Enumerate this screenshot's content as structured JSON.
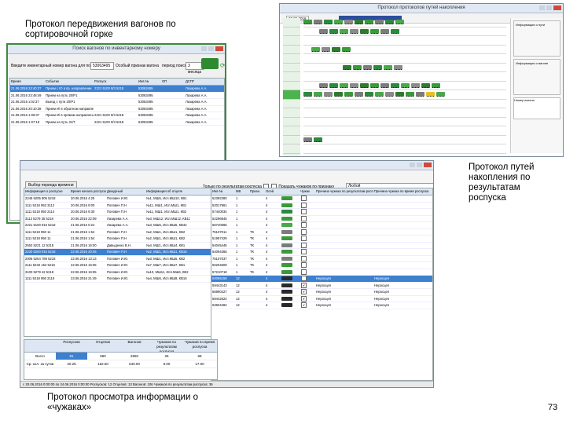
{
  "captions": {
    "top": [
      "Протокол передвижения вагонов по",
      "сортировочной горке"
    ],
    "right": [
      "Протокол путей",
      "накопления по",
      "результатам",
      "роспуска"
    ],
    "bottom": [
      "Протокол просмотра информации о",
      "«чужаках»"
    ]
  },
  "slide_number": "73",
  "win1": {
    "title": "Поиск вагонов по инвентарному номеру",
    "search_label": "Введите инвентарный номер вагона для поиска",
    "search_value": "53063495",
    "sign_label": "Особый признак вагона",
    "period_label": "период поиска",
    "period_value": "3 месяца",
    "find_button": "Найти",
    "columns": [
      "Время",
      "Событие",
      "Роспуск",
      "Инв №",
      "ОП",
      "ДСПГ"
    ],
    "rows": [
      [
        "21.06.2016 23:40:37",
        "Прием с Ю в пр. направлении",
        "2221 5100 9/3 5218",
        "53063495",
        "",
        "Лазарева А.А."
      ],
      [
        "21.06.2016 23:48:49",
        "Прием на путь 20/Р1",
        "",
        "53063495",
        "",
        "Лазарева А.А."
      ],
      [
        "21.06.2016 з:02:37",
        "Выезд с пути 20/Р1",
        "",
        "53063495",
        "",
        "Лазарева А.А."
      ],
      [
        "21.06.2016 20:10:38",
        "Прием И/ в обратном направлении",
        "",
        "53063495",
        "",
        "Лазарева А.А."
      ],
      [
        "21.06.2016 1:06:37",
        "Прием И/ в прямом направлении",
        "2221 5100 9/3 5218",
        "53063495",
        "",
        "Лазарева А.А."
      ],
      [
        "21.06.2016 1:07:18",
        "Прием на путь 31/Т",
        "2221 5100 9/3 5218",
        "53063495",
        "",
        "Лазарева А.А."
      ]
    ]
  },
  "win2": {
    "title": "Протокол протоколов путей накопления",
    "date": "22.06.2016",
    "panel_labels": [
      "Информация о пути",
      "Информация о вагоне",
      "Номер вагона"
    ]
  },
  "win3": {
    "title": "",
    "choose_period": "Выбор периода времени",
    "only_results": "Только по результатам роспуска",
    "show_aliens": "Показать чужаков по признаку",
    "reason_value": "Любой",
    "left_columns": [
      "Информация о роспуске",
      "Время начала роспуска",
      "Дежурный",
      "Информация об отцепе"
    ],
    "left_rows": [
      [
        "2246 5205 905 5218",
        "20.06.2016 4:25",
        "Попович И.Ю.",
        "№1, МШ5, Исп.МШ10, КВ1"
      ],
      [
        "1111 5218 953 3112",
        "20.06.2016 9:00",
        "Попович П.Н",
        "№11, МШ1, Исп.МШ1, КВ1"
      ],
      [
        "1111 5218 950 2114",
        "20.06.2016 9:30",
        "Попович П.Н",
        "№11, МШ1, Исп.МШ1, КВ2"
      ],
      [
        "3113 5279 35 5218",
        "20.06.2016 22:09",
        "Лазарева А.А.",
        "№3, МШ12, Исп.МШ12, КВ11"
      ],
      [
        "2221 5100 915 5218",
        "21.06.2016 0:24",
        "Лазарева А.А.",
        "№3, МШ5, Исп.МШ5, КВ42"
      ],
      [
        "1111 5218 950 11",
        "21.06.2016 1:54",
        "Попович П.Н",
        "№2, МШ1, Исп.МШ1, КВ2"
      ],
      [
        "1111 5218 950 11",
        "21.06.2016 1:54",
        "Попович П.Н",
        "№2, МШ1, Исп.МШ1, КВ2"
      ],
      [
        "2553 5221 12 5218",
        "21.06.2016 16:00",
        "Давыденко В.Н.",
        "№4, МШ1, Исп.МШ4, КВ1"
      ],
      [
        "2230 5200 915 5218",
        "22.06.2016 20:46",
        "Попович П.Н",
        "№2, МШ1, Исп.МШ1, КВ18"
      ],
      [
        "2006 5264 789 5218",
        "22.06.2016 13:13",
        "Попович И.Ю.",
        "№3, МШ1, Исп.МШ5, КВ2"
      ],
      [
        "2111 5232 152 5218",
        "22.06.2016 16:05",
        "Попович И.Ю.",
        "№7, МШ7, Исп.МШ7, КВ1"
      ],
      [
        "3100 5279 42 5218",
        "22.06.2016 16:55",
        "Попович И.Ю.",
        "№10, МШ11, Исп.МШ6, КВ2"
      ],
      [
        "1111 5218 950 2116",
        "23.06.2016 21:49",
        "Попович И.Ю.",
        "№4, МШ6, Исп.МШ8, КВ16"
      ]
    ],
    "right_columns": [
      "Инв №",
      "МВ",
      "Призн.",
      "Осей",
      "",
      "Чужак",
      "Причина чужака по результатам роспуска",
      "Причина чужака по время роспуска"
    ],
    "right_rows": [
      [
        "52392380",
        "1",
        "",
        "4",
        "",
        "",
        "",
        ""
      ],
      [
        "52017861",
        "1",
        "",
        "4",
        "",
        "",
        "",
        ""
      ],
      [
        "57440034",
        "1",
        "",
        "4",
        "",
        "",
        "",
        ""
      ],
      [
        "52296845",
        "1",
        "",
        "4",
        "",
        "",
        "",
        ""
      ],
      [
        "56740665",
        "1",
        "",
        "4",
        "",
        "",
        "",
        ""
      ],
      [
        "75107011",
        "1",
        "ТК",
        "4",
        "",
        "",
        "",
        ""
      ],
      [
        "51957429",
        "1",
        "ТК",
        "4",
        "",
        "",
        "",
        ""
      ],
      [
        "54045446",
        "1",
        "ТК",
        "4",
        "",
        "",
        "",
        ""
      ],
      [
        "54094366",
        "1",
        "ТК",
        "4",
        "",
        "",
        "",
        ""
      ],
      [
        "75107037",
        "1",
        "ТК",
        "4",
        "",
        "",
        "",
        ""
      ],
      [
        "50204509",
        "1",
        "ТК",
        "4",
        "",
        "",
        "",
        ""
      ],
      [
        "57210718",
        "1",
        "ТК",
        "4",
        "",
        "",
        "",
        ""
      ],
      [
        "50065158",
        "12",
        "",
        "4",
        "",
        "✔",
        "Неросцеп",
        "Неросцеп"
      ],
      [
        "59443143",
        "12",
        "",
        "4",
        "",
        "✔",
        "Неросцеп",
        "Неросцеп"
      ],
      [
        "56990227",
        "12",
        "",
        "4",
        "",
        "✔",
        "Неросцеп",
        "Неросцеп"
      ],
      [
        "59442624",
        "12",
        "",
        "4",
        "",
        "✔",
        "Неросцеп",
        "Неросцеп"
      ],
      [
        "53604484",
        "12",
        "",
        "4",
        "",
        "✔",
        "Неросцеп",
        "Неросцеп"
      ]
    ],
    "summary_columns": [
      "",
      "Роспусков",
      "Отцепов",
      "Вагонов",
      "Чужаков по результатам роспуска",
      "Чужаков по время роспуска"
    ],
    "summary_rows": [
      [
        "Всего",
        "81",
        "650",
        "2560",
        "26",
        "68"
      ],
      [
        "Ср. кол. за сутки",
        "20.25",
        "162.50",
        "640.00",
        "9.00",
        "17.00"
      ]
    ],
    "status": "с 20.06.2016 0:00:00 по 24.06.2016 0:00:00 Роспусков: 12  Отцепов: 13  Вагонов: 106  Чужаков по результатам роспуска: 36"
  },
  "colors": {
    "window_border_green": "#3c8a3c",
    "selection_blue": "#3d80d0",
    "header_bg": "#dce7f3",
    "wagon_green": "#3a9a3a",
    "wagon_gray": "#7c7c7c"
  }
}
